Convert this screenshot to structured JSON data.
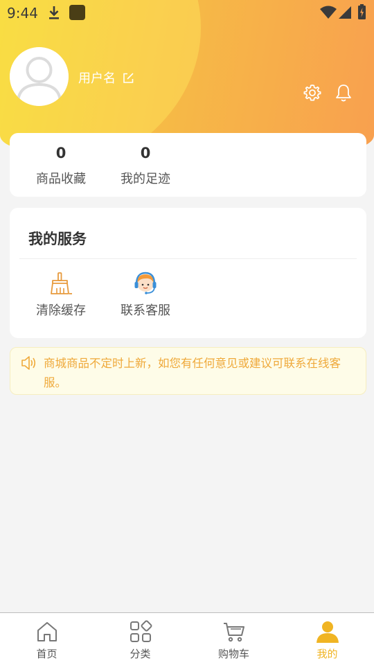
{
  "status_bar": {
    "time": "9:44",
    "icons": [
      "download-icon",
      "app-icon",
      "wifi-icon",
      "signal-icon",
      "battery-icon"
    ]
  },
  "profile": {
    "username": "用户名",
    "icons": [
      "avatar-placeholder",
      "edit-icon",
      "gear-icon",
      "bell-icon"
    ]
  },
  "stats": [
    {
      "value": "0",
      "label": "商品收藏"
    },
    {
      "value": "0",
      "label": "我的足迹"
    }
  ],
  "services": {
    "title": "我的服务",
    "items": [
      {
        "label": "清除缓存",
        "icon": "broom-icon"
      },
      {
        "label": "联系客服",
        "icon": "customer-service-icon"
      }
    ]
  },
  "notice": {
    "icon": "speaker-icon",
    "text": "商城商品不定时上新，如您有任何意见或建议可联系在线客服。"
  },
  "bottom_nav": {
    "items": [
      {
        "label": "首页",
        "icon": "home-icon",
        "active": false
      },
      {
        "label": "分类",
        "icon": "category-icon",
        "active": false
      },
      {
        "label": "购物车",
        "icon": "cart-icon",
        "active": false
      },
      {
        "label": "我的",
        "icon": "person-icon",
        "active": true
      }
    ]
  },
  "colors": {
    "accent": "#f0b423",
    "header_start": "#f4d630",
    "header_end": "#f8a04f",
    "notice_text": "#efa93a",
    "notice_bg": "#fefce8"
  }
}
